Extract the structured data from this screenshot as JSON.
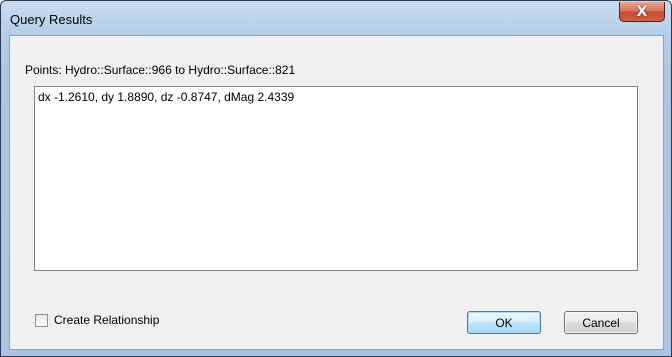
{
  "window": {
    "title": "Query Results",
    "close_glyph": "X"
  },
  "query": {
    "points_label": "Points: Hydro::Surface::966 to Hydro::Surface::821",
    "result_text": "dx -1.2610, dy 1.8890, dz -0.8747, dMag 2.4339"
  },
  "options": {
    "create_relationship_label": "Create Relationship",
    "create_relationship_checked": false
  },
  "buttons": {
    "ok_label": "OK",
    "cancel_label": "Cancel"
  }
}
